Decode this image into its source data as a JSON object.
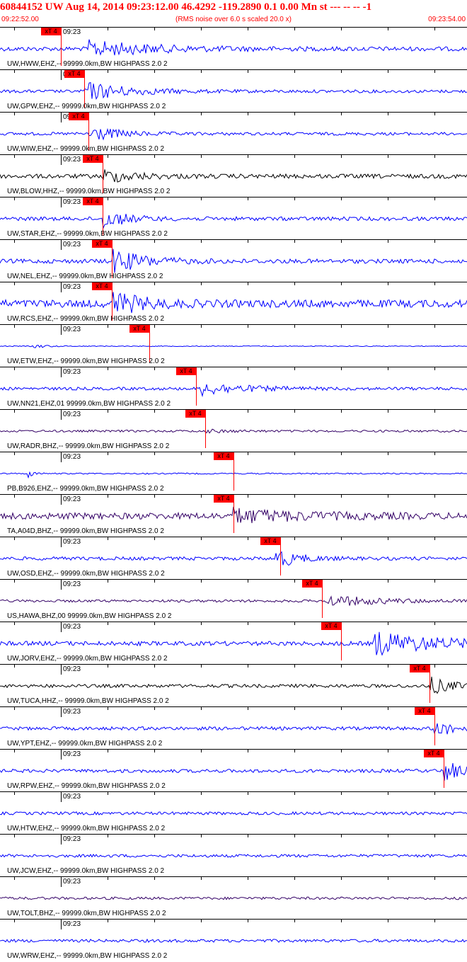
{
  "header": {
    "title": "60844152 UW Aug 14, 2014 09:23:12.00   46.4292 -119.2890  0.1 0.00 Mn st --- -- --   -1",
    "start_time": "09:22:52.00",
    "noise_note": "(RMS noise over 6.0 s scaled 20.0 x)",
    "end_time": "09:23:54.00"
  },
  "pick_label": "xT 4",
  "tick_label": "09:23",
  "colors": {
    "blue": "#0000ff",
    "black": "#000000",
    "purple": "#330066",
    "pick": "#ff0000"
  },
  "traces": [
    {
      "label": "UW,HWW,EHZ,-- 99999.0km,BW  HIGHPASS  2.0  2",
      "color": "blue",
      "pick": 0.13,
      "burst": 0.19,
      "amp": 0.35,
      "dur": 0.12,
      "noise": 0.1
    },
    {
      "label": "UW,GPW,EHZ,-- 99999.0km,BW  HIGHPASS  2.0  2",
      "color": "blue",
      "pick": 0.18,
      "burst": 0.18,
      "amp": 0.45,
      "dur": 0.08,
      "noise": 0.07
    },
    {
      "label": "UW,WIW,EHZ,-- 99999.0km,BW  HIGHPASS  2.0  2",
      "color": "blue",
      "pick": 0.19,
      "burst": 0.19,
      "amp": 0.4,
      "dur": 0.05,
      "noise": 0.07
    },
    {
      "label": "UW,BLOW,HHZ,-- 99999.0km,BW  HIGHPASS  2.0  2",
      "color": "black",
      "pick": 0.22,
      "burst": 0.22,
      "amp": 0.3,
      "dur": 0.06,
      "noise": 0.1
    },
    {
      "label": "UW,STAR,EHZ,-- 99999.0km,BW  HIGHPASS  2.0  2",
      "color": "blue",
      "pick": 0.22,
      "burst": 0.22,
      "amp": 0.45,
      "dur": 0.04,
      "noise": 0.09
    },
    {
      "label": "UW,NEL,EHZ,-- 99999.0km,BW  HIGHPASS  2.0  2",
      "color": "blue",
      "pick": 0.24,
      "burst": 0.24,
      "amp": 0.55,
      "dur": 0.06,
      "noise": 0.1
    },
    {
      "label": "UW,RCS,EHZ,-- 99999.0km,BW  HIGHPASS  2.0  2",
      "color": "blue",
      "pick": 0.24,
      "burst": 0.24,
      "amp": 0.55,
      "dur": 0.05,
      "noise": 0.18
    },
    {
      "label": "UW,ETW,EHZ,-- 99999.0km,BW  HIGHPASS  2.0  2",
      "color": "blue",
      "pick": 0.32,
      "burst": 0.07,
      "amp": 0.12,
      "dur": 0.02,
      "noise": 0.02
    },
    {
      "label": "UW,NN21,EHZ,01 99999.0km,BW  HIGHPASS  2.0  2",
      "color": "blue",
      "pick": 0.42,
      "burst": 0.43,
      "amp": 0.3,
      "dur": 0.08,
      "noise": 0.07
    },
    {
      "label": "UW,RADR,BHZ,-- 99999.0km,BW  HIGHPASS  2.0  2",
      "color": "purple",
      "pick": 0.44,
      "burst": 0.44,
      "amp": 0.06,
      "dur": 0.05,
      "noise": 0.05
    },
    {
      "label": "PB,B926,EHZ,-- 99999.0km,BW  HIGHPASS  2.0  2",
      "color": "blue",
      "pick": 0.5,
      "burst": 0.06,
      "amp": 0.18,
      "dur": 0.01,
      "noise": 0.03
    },
    {
      "label": "TA,A04D,BHZ,-- 99999.0km,BW  HIGHPASS  2.0  2",
      "color": "purple",
      "pick": 0.5,
      "burst": 0.5,
      "amp": 0.3,
      "dur": 0.12,
      "noise": 0.15
    },
    {
      "label": "UW,OSD,EHZ,-- 99999.0km,BW  HIGHPASS  2.0  2",
      "color": "blue",
      "pick": 0.6,
      "burst": 0.59,
      "amp": 0.45,
      "dur": 0.04,
      "noise": 0.08
    },
    {
      "label": "US,HAWA,BHZ,00 99999.0km,BW  HIGHPASS  2.0  2",
      "color": "purple",
      "pick": 0.69,
      "burst": 0.7,
      "amp": 0.25,
      "dur": 0.1,
      "noise": 0.06
    },
    {
      "label": "UW,JORV,EHZ,-- 99999.0km,BW  HIGHPASS  2.0  2",
      "color": "blue",
      "pick": 0.73,
      "burst": 0.8,
      "amp": 0.55,
      "dur": 0.12,
      "noise": 0.1
    },
    {
      "label": "UW,TUCA,HHZ,-- 99999.0km,BW  HIGHPASS  2.0  2",
      "color": "black",
      "pick": 0.92,
      "burst": 0.92,
      "amp": 0.4,
      "dur": 0.04,
      "noise": 0.08
    },
    {
      "label": "UW,YPT,EHZ,-- 99999.0km,BW  HIGHPASS  2.0  2",
      "color": "blue",
      "pick": 0.93,
      "burst": 0.93,
      "amp": 0.45,
      "dur": 0.03,
      "noise": 0.08
    },
    {
      "label": "UW,RPW,EHZ,-- 99999.0km,BW  HIGHPASS  2.0  2",
      "color": "blue",
      "pick": 0.95,
      "burst": 0.95,
      "amp": 0.55,
      "dur": 0.03,
      "noise": 0.08
    },
    {
      "label": "UW,HTW,EHZ,-- 99999.0km,BW  HIGHPASS  2.0  2",
      "color": "blue",
      "pick": null,
      "burst": null,
      "amp": 0,
      "dur": 0,
      "noise": 0.07
    },
    {
      "label": "UW,JCW,EHZ,-- 99999.0km,BW  HIGHPASS  2.0  2",
      "color": "blue",
      "pick": null,
      "burst": null,
      "amp": 0,
      "dur": 0,
      "noise": 0.07
    },
    {
      "label": "UW,TOLT,BHZ,-- 99999.0km,BW  HIGHPASS  2.0  2",
      "color": "purple",
      "pick": null,
      "burst": null,
      "amp": 0,
      "dur": 0,
      "noise": 0.06
    },
    {
      "label": "UW,WRW,EHZ,-- 99999.0km,BW  HIGHPASS  2.0  2",
      "color": "blue",
      "pick": null,
      "burst": null,
      "amp": 0,
      "dur": 0,
      "noise": 0.07
    }
  ]
}
